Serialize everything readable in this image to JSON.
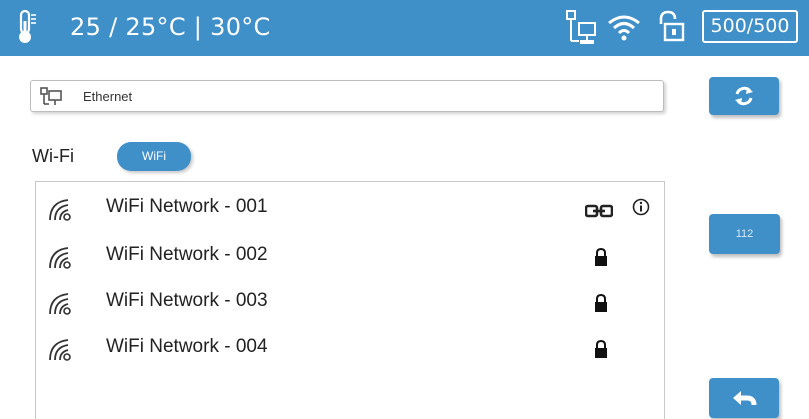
{
  "header": {
    "temperature": "25 / 25°C | 30°C",
    "count": "500/500",
    "icons": [
      "thermometer-icon",
      "network-icon",
      "wifi-icon",
      "unlock-icon"
    ]
  },
  "ethernet": {
    "label": "Ethernet",
    "icon": "ethernet-icon"
  },
  "wifi": {
    "label": "Wi-Fi",
    "toggle_label": "WiFi"
  },
  "networks": [
    {
      "name": "WiFi Network - 001",
      "status": "connected",
      "icons": [
        "link-icon",
        "info-icon"
      ]
    },
    {
      "name": "WiFi Network - 002",
      "status": "locked",
      "icons": [
        "lock-icon"
      ]
    },
    {
      "name": "WiFi Network - 003",
      "status": "locked",
      "icons": [
        "lock-icon"
      ]
    },
    {
      "name": "WiFi Network - 004",
      "status": "locked",
      "icons": [
        "lock-icon"
      ]
    }
  ],
  "side": {
    "refresh_icon": "refresh-icon",
    "freq_label": "112",
    "back_icon": "back-arrow-icon"
  },
  "colors": {
    "accent": "#3f8fc9",
    "header_text": "#ffffff"
  }
}
